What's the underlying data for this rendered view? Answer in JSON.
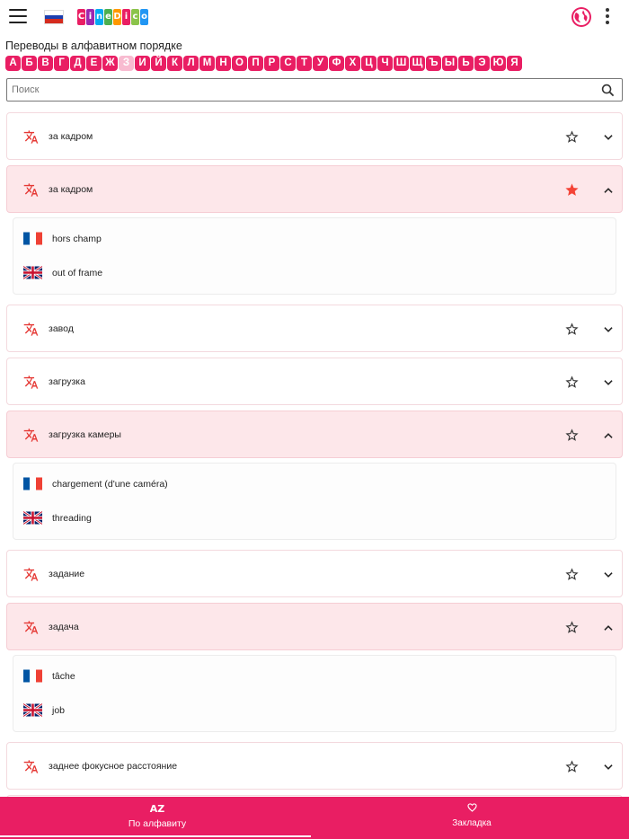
{
  "appbar": {
    "logo_letters": [
      "C",
      "i",
      "n",
      "e",
      "D",
      "i",
      "c",
      "o"
    ],
    "logo_colors": [
      "#e91e63",
      "#9c27b0",
      "#03a9f4",
      "#4caf50",
      "#ff9800",
      "#e91e63",
      "#8bc34a",
      "#2196f3"
    ]
  },
  "page": {
    "heading": "Переводы в алфавитном порядке",
    "active_letter": "З",
    "letters": [
      "А",
      "Б",
      "В",
      "Г",
      "Д",
      "Е",
      "Ж",
      "З",
      "И",
      "Й",
      "К",
      "Л",
      "М",
      "Н",
      "О",
      "П",
      "Р",
      "С",
      "Т",
      "У",
      "Ф",
      "Х",
      "Ц",
      "Ч",
      "Ш",
      "Щ",
      "Ъ",
      "Ы",
      "Ь",
      "Э",
      "Ю",
      "Я"
    ]
  },
  "search": {
    "placeholder": "Поиск",
    "value": ""
  },
  "entries": [
    {
      "term": "за кадром",
      "expanded": false,
      "favorite": false,
      "translations": []
    },
    {
      "term": "за кадром",
      "expanded": true,
      "favorite": true,
      "translations": [
        {
          "lang": "fr",
          "text": "hors champ"
        },
        {
          "lang": "en",
          "text": "out of frame"
        }
      ]
    },
    {
      "term": "завод",
      "expanded": false,
      "favorite": false,
      "translations": []
    },
    {
      "term": "загрузка",
      "expanded": false,
      "favorite": false,
      "translations": []
    },
    {
      "term": "загрузка камеры",
      "expanded": true,
      "favorite": false,
      "translations": [
        {
          "lang": "fr",
          "text": "chargement (d'une caméra)"
        },
        {
          "lang": "en",
          "text": "threading"
        }
      ]
    },
    {
      "term": "задание",
      "expanded": false,
      "favorite": false,
      "translations": []
    },
    {
      "term": "задача",
      "expanded": true,
      "favorite": false,
      "translations": [
        {
          "lang": "fr",
          "text": "tâche"
        },
        {
          "lang": "en",
          "text": "job"
        }
      ]
    },
    {
      "term": "заднее фокусное расстояние",
      "expanded": false,
      "favorite": false,
      "translations": []
    },
    {
      "term": "",
      "expanded": false,
      "favorite": false,
      "translations": []
    }
  ],
  "bottom_nav": {
    "tabs": [
      {
        "label": "По алфавиту",
        "icon": "AZ",
        "selected": true
      },
      {
        "label": "Закладка",
        "icon": "heart-icon",
        "selected": false
      }
    ]
  },
  "colors": {
    "accent": "#e91e63",
    "expanded_bg": "#fde7ea",
    "star_filled": "#f44336"
  }
}
